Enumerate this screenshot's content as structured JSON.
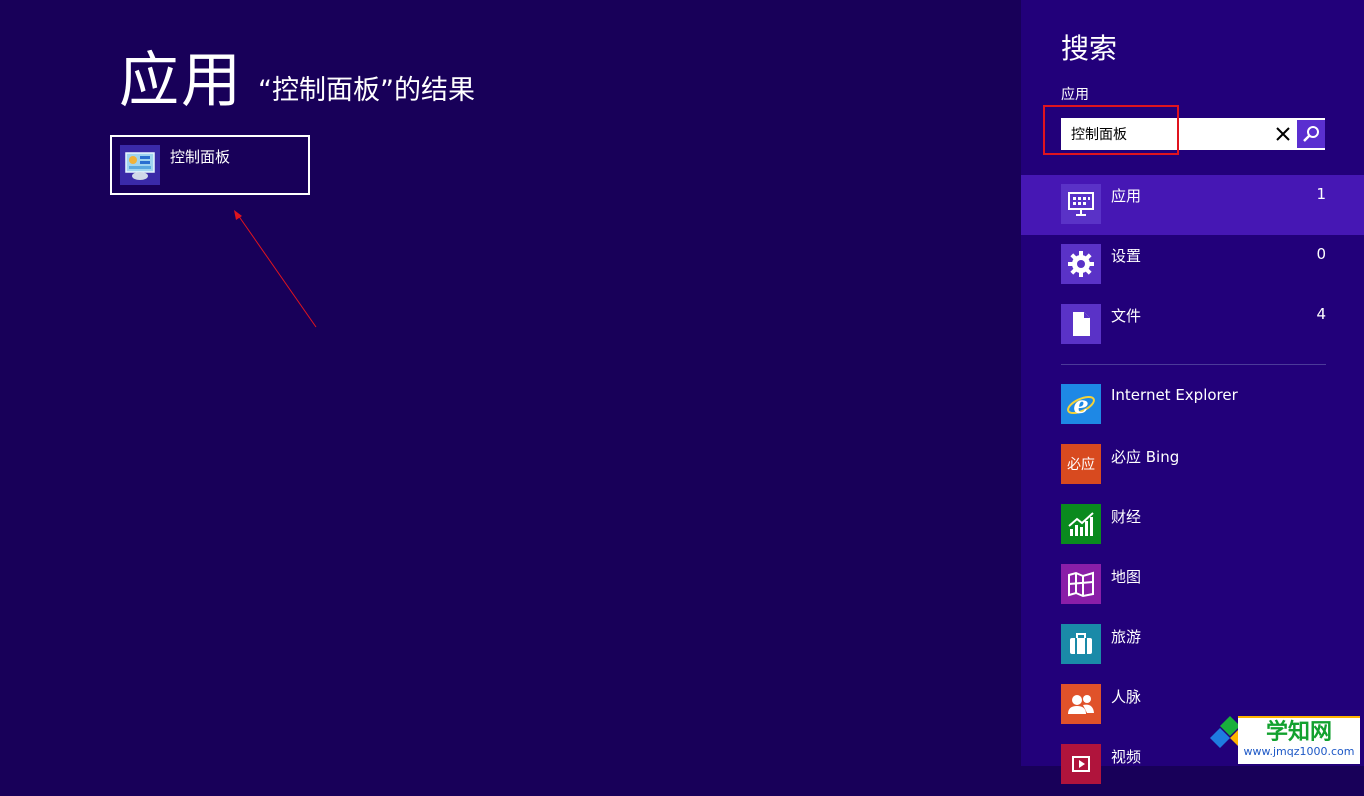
{
  "main": {
    "title": "应用",
    "subtitle": "“控制面板”的结果",
    "results": [
      {
        "label": "控制面板",
        "icon": "control-panel-icon"
      }
    ]
  },
  "search": {
    "title": "搜索",
    "scope_label": "应用",
    "query": "控制面板",
    "clear_icon": "close-icon",
    "submit_icon": "search-icon",
    "scopes": [
      {
        "label": "应用",
        "count": "1",
        "icon": "apps-icon",
        "selected": true
      },
      {
        "label": "设置",
        "count": "0",
        "icon": "gear-icon",
        "selected": false
      },
      {
        "label": "文件",
        "count": "4",
        "icon": "file-icon",
        "selected": false
      }
    ],
    "apps": [
      {
        "label": "Internet Explorer",
        "icon": "internet-explorer-icon",
        "color": "#1e88e5"
      },
      {
        "label": "必应 Bing",
        "icon": "bing-icon",
        "icon_text": "必应",
        "color": "#d84a1f"
      },
      {
        "label": "财经",
        "icon": "finance-icon",
        "color": "#0a8a1e"
      },
      {
        "label": "地图",
        "icon": "map-icon",
        "color": "#8a1ea8"
      },
      {
        "label": "旅游",
        "icon": "travel-icon",
        "color": "#1a8aa8"
      },
      {
        "label": "人脉",
        "icon": "people-icon",
        "color": "#e0522a"
      },
      {
        "label": "视频",
        "icon": "video-icon",
        "color": "#b0143c"
      }
    ]
  },
  "watermark": {
    "line1": "学知网",
    "line2": "www.jmqz1000.com"
  }
}
